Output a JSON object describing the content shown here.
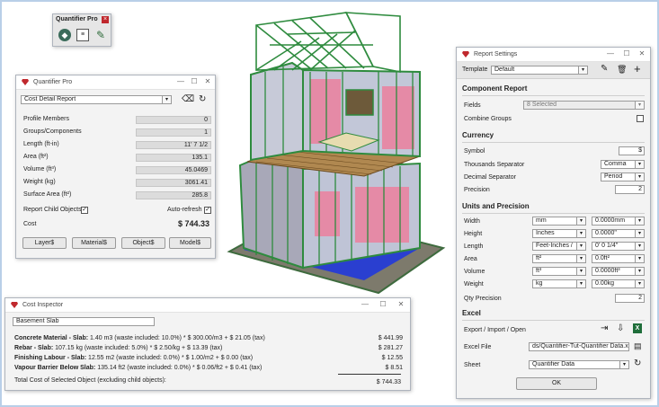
{
  "toolbar": {
    "title": "Quantifier Pro"
  },
  "qp": {
    "title": "Quantifier Pro",
    "report_select": "Cost Detail Report",
    "rows": [
      {
        "label": "Profile Members",
        "value": "0"
      },
      {
        "label": "Groups/Components",
        "value": "1"
      },
      {
        "label": "Length (ft-in)",
        "value": "11' 7 1/2"
      },
      {
        "label": "Area (ft²)",
        "value": "135.1"
      },
      {
        "label": "Volume (ft³)",
        "value": "45.0469"
      },
      {
        "label": "Weight (kg)",
        "value": "3061.41"
      },
      {
        "label": "Surface Area (ft²)",
        "value": "285.8"
      }
    ],
    "report_child_label": "Report Child Objects",
    "report_child_checked": "✓",
    "auto_refresh_label": "Auto-refresh",
    "auto_refresh_checked": "✓",
    "cost_label": "Cost",
    "cost_value": "$ 744.33",
    "buttons": [
      "Layer$",
      "Material$",
      "Object$",
      "Model$"
    ]
  },
  "ci": {
    "title": "Cost Inspector",
    "name_field": "Basement Slab",
    "lines": [
      {
        "bold": "Concrete Material - Slab:",
        "rest": " 1.40 m3 (waste included: 10.0%) * $ 300.00/m3 + $ 21.05 (tax)",
        "amount": "$ 441.99"
      },
      {
        "bold": "Rebar - Slab:",
        "rest": " 107.15 kg (waste included: 5.0%) * $ 2.50/kg + $ 13.39 (tax)",
        "amount": "$ 281.27"
      },
      {
        "bold": "Finishing Labour - Slab:",
        "rest": " 12.55 m2 (waste included: 0.0%) * $ 1.00/m2 + $ 0.00 (tax)",
        "amount": "$ 12.55"
      },
      {
        "bold": "Vapour Barrier Below Slab:",
        "rest": " 135.14 ft2 (waste included: 0.0%) * $ 0.06/ft2 + $ 0.41 (tax)",
        "amount": "$ 8.51"
      }
    ],
    "total_label": "Total Cost of Selected Object (excluding child objects):",
    "total_value": "$ 744.33"
  },
  "rs": {
    "title": "Report Settings",
    "template_label": "Template",
    "template_value": "Default",
    "component_header": "Component Report",
    "fields_label": "Fields",
    "fields_value": "8 Selected",
    "combine_label": "Combine Groups",
    "currency_header": "Currency",
    "symbol_label": "Symbol",
    "symbol_value": "$",
    "thousands_label": "Thousands Separator",
    "thousands_value": "Comma",
    "decimal_label": "Decimal Separator",
    "decimal_value": "Period",
    "precision_label": "Precision",
    "precision_value": "2",
    "units_header": "Units and Precision",
    "units": [
      {
        "label": "Width",
        "unit": "mm",
        "precision": "0.0000mm"
      },
      {
        "label": "Height",
        "unit": "Inches",
        "precision": "0.0000\""
      },
      {
        "label": "Length",
        "unit": "Feet-Inches /",
        "precision": "0' 0 1/4\""
      },
      {
        "label": "Area",
        "unit": "ft²",
        "precision": "0.0ft²"
      },
      {
        "label": "Volume",
        "unit": "ft³",
        "precision": "0.0000ft³"
      },
      {
        "label": "Weight",
        "unit": "kg",
        "precision": "0.00kg"
      }
    ],
    "qty_label": "Qty Precision",
    "qty_value": "2",
    "excel_header": "Excel",
    "export_label": "Export / Import / Open",
    "excel_file_label": "Excel File",
    "excel_file_value": "ds/Quantifier-Tut-Quantifier Data.xlsx",
    "sheet_label": "Sheet",
    "sheet_value": "Quantifier Data",
    "ok_label": "OK"
  },
  "colors": {
    "ruby": "#c0282d",
    "frame": "#2e8b3e",
    "wall_pink": "#e58aa6",
    "floor_blue": "#2a3fd0",
    "wood": "#b08850"
  }
}
